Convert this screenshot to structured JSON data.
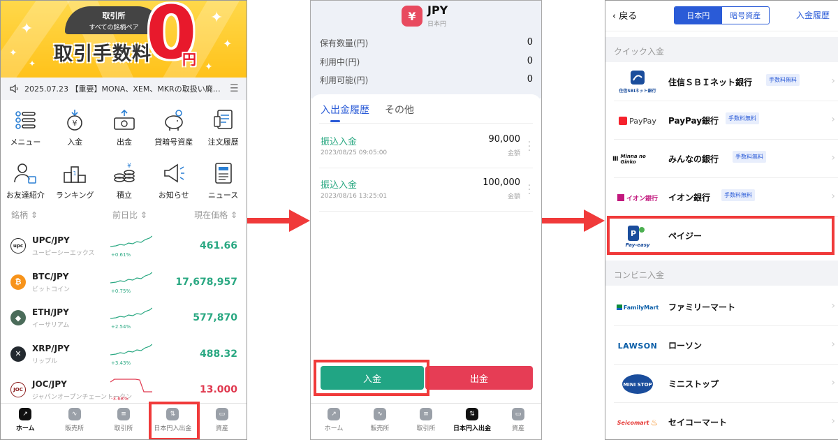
{
  "phone1": {
    "banner": {
      "pill_line1": "取引所",
      "pill_line2": "すべての銘柄ペア",
      "fee": "取引手数料",
      "zero": "0",
      "yen": "円"
    },
    "notice": "2025.07.23 【重要】MONA、XEM、MKRの取扱い廃…",
    "menu": [
      {
        "label": "メニュー",
        "icon": "menu-icon"
      },
      {
        "label": "入金",
        "icon": "deposit-icon"
      },
      {
        "label": "出金",
        "icon": "withdraw-icon"
      },
      {
        "label": "貸暗号資産",
        "icon": "piggy-bank-icon"
      },
      {
        "label": "注文履歴",
        "icon": "order-history-icon"
      },
      {
        "label": "お友達紹介",
        "icon": "friend-invite-icon"
      },
      {
        "label": "ランキング",
        "icon": "ranking-icon"
      },
      {
        "label": "積立",
        "icon": "coins-icon"
      },
      {
        "label": "お知らせ",
        "icon": "megaphone-icon"
      },
      {
        "label": "ニュース",
        "icon": "news-icon"
      }
    ],
    "market_headers": {
      "name": "銘柄 ⇕",
      "change": "前日比 ⇕",
      "price": "現在価格 ⇕"
    },
    "markets": [
      {
        "pair": "UPC/JPY",
        "jp": "ユーピーシーエックス",
        "change": "+0.61%",
        "price": "461.66",
        "color": "#2aa882",
        "coin_bg": "#ffffff",
        "coin_text": "upc",
        "coin_fg": "#222222"
      },
      {
        "pair": "BTC/JPY",
        "jp": "ビットコイン",
        "change": "+0.75%",
        "price": "17,678,957",
        "color": "#2aa882",
        "coin_bg": "#f7931a",
        "coin_text": "₿",
        "coin_fg": "#ffffff"
      },
      {
        "pair": "ETH/JPY",
        "jp": "イーサリアム",
        "change": "+2.54%",
        "price": "577,870",
        "color": "#2aa882",
        "coin_bg": "#4b6c5a",
        "coin_text": "◆",
        "coin_fg": "#ffffff"
      },
      {
        "pair": "XRP/JPY",
        "jp": "リップル",
        "change": "+3.43%",
        "price": "488.32",
        "color": "#2aa882",
        "coin_bg": "#23292f",
        "coin_text": "✕",
        "coin_fg": "#ffffff"
      },
      {
        "pair": "JOC/JPY",
        "jp": "ジャパンオープンチェーントークン",
        "change": "-3.68%",
        "price": "13.000",
        "color": "#e03a50",
        "coin_bg": "#ffffff",
        "coin_text": "JOC",
        "coin_fg": "#8a1a1a"
      }
    ],
    "tabs": [
      {
        "label": "ホーム",
        "active": true
      },
      {
        "label": "販売所",
        "active": false
      },
      {
        "label": "取引所",
        "active": false
      },
      {
        "label": "日本円入出金",
        "active": false
      },
      {
        "label": "資産",
        "active": false
      }
    ]
  },
  "phone2": {
    "currency": "JPY",
    "currency_sub": "日本円",
    "currency_icon": "¥",
    "balances": [
      {
        "label": "保有数量(円)",
        "value": "0"
      },
      {
        "label": "利用中(円)",
        "value": "0"
      },
      {
        "label": "利用可能(円)",
        "value": "0"
      }
    ],
    "tabs": [
      {
        "label": "入出金履歴",
        "active": true
      },
      {
        "label": "その他",
        "active": false
      }
    ],
    "transactions": [
      {
        "kind": "振込入金",
        "date": "2023/08/25 09:05:00",
        "amount": "90,000",
        "amount_label": "金額"
      },
      {
        "kind": "振込入金",
        "date": "2023/08/16 13:25:01",
        "amount": "100,000",
        "amount_label": "金額"
      }
    ],
    "deposit_button": "入金",
    "withdraw_button": "出金",
    "tabs_bottom": [
      {
        "label": "ホーム",
        "active": false
      },
      {
        "label": "販売所",
        "active": false
      },
      {
        "label": "取引所",
        "active": false
      },
      {
        "label": "日本円入出金",
        "active": true
      },
      {
        "label": "資産",
        "active": false
      }
    ]
  },
  "phone3": {
    "back": "戻る",
    "segments": [
      {
        "label": "日本円",
        "active": true
      },
      {
        "label": "暗号資産",
        "active": false
      }
    ],
    "history": "入金履歴",
    "section_quick": "クイック入金",
    "section_conv": "コンビニ入金",
    "quick": [
      {
        "name": "住信ＳＢＩネット銀行",
        "tag": "手数料無料",
        "logo": "住信SBIネット銀行"
      },
      {
        "name": "PayPay銀行",
        "tag": "手数料無料",
        "logo": "PayPay"
      },
      {
        "name": "みんなの銀行",
        "tag": "手数料無料",
        "logo": "Minna no Ginko"
      },
      {
        "name": "イオン銀行",
        "tag": "手数料無料",
        "logo": "イオン銀行"
      },
      {
        "name": "ペイジー",
        "tag": "",
        "logo": "Pay-easy"
      }
    ],
    "conv": [
      {
        "name": "ファミリーマート",
        "logo": "FamilyMart"
      },
      {
        "name": "ローソン",
        "logo": "LAWSON"
      },
      {
        "name": "ミニストップ",
        "logo": "MINI STOP"
      },
      {
        "name": "セイコーマート",
        "logo": "Seicomart"
      }
    ]
  },
  "colors": {
    "accent": "#2a5bd7",
    "green": "#2aa882",
    "red": "#e03a50",
    "highlight": "#f03a3a"
  }
}
